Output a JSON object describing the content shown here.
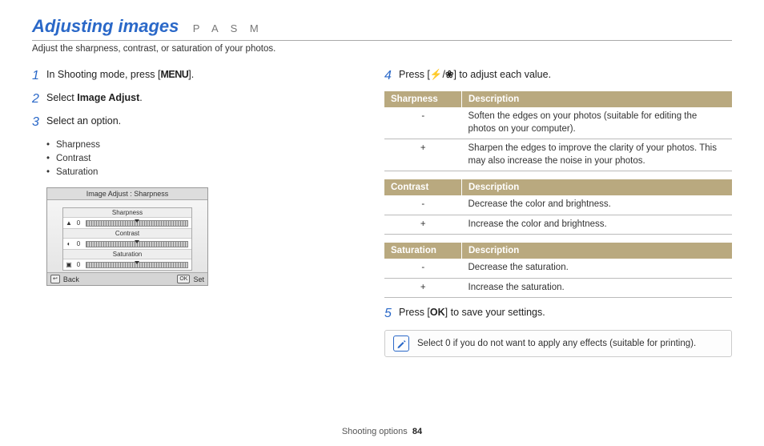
{
  "header": {
    "title": "Adjusting images",
    "modes": "P A S M",
    "subtitle": "Adjust the sharpness, contrast, or saturation of your photos."
  },
  "steps": {
    "s1": {
      "num": "1",
      "pre": "In Shooting mode, press [",
      "menu": "MENU",
      "post": "]."
    },
    "s2": {
      "num": "2",
      "pre": "Select ",
      "bold": "Image Adjust",
      "post": "."
    },
    "s3": {
      "num": "3",
      "text": "Select an option.",
      "bullets": [
        "Sharpness",
        "Contrast",
        "Saturation"
      ]
    },
    "s4": {
      "num": "4",
      "pre": "Press [",
      "icon1": "⚡",
      "sep": "/",
      "icon2": "❀",
      "post": "] to adjust each value."
    },
    "s5": {
      "num": "5",
      "pre": "Press [",
      "ok": "OK",
      "post": "] to save your settings."
    }
  },
  "camera": {
    "title": "Image Adjust : Sharpness",
    "row_labels": [
      "Sharpness",
      "Contrast",
      "Saturation"
    ],
    "row_vals": [
      "0",
      "0",
      "0"
    ],
    "icons": [
      "▲",
      "◐",
      "▣"
    ],
    "back_icon": "↩",
    "back": "Back",
    "ok_icon": "OK",
    "set": "Set"
  },
  "tables": {
    "sharpness": {
      "head1": "Sharpness",
      "head2": "Description",
      "rows": [
        {
          "k": "-",
          "v": "Soften the edges on your photos (suitable for editing the photos on your computer)."
        },
        {
          "k": "+",
          "v": "Sharpen the edges to improve the clarity of your photos. This may also increase the noise in your photos."
        }
      ]
    },
    "contrast": {
      "head1": "Contrast",
      "head2": "Description",
      "rows": [
        {
          "k": "-",
          "v": "Decrease the color and brightness."
        },
        {
          "k": "+",
          "v": "Increase the color and brightness."
        }
      ]
    },
    "saturation": {
      "head1": "Saturation",
      "head2": "Description",
      "rows": [
        {
          "k": "-",
          "v": "Decrease the saturation."
        },
        {
          "k": "+",
          "v": "Increase the saturation."
        }
      ]
    }
  },
  "note": {
    "icon": "✎",
    "text": "Select 0 if you do not want to apply any effects (suitable for printing)."
  },
  "footer": {
    "section": "Shooting options",
    "page": "84"
  }
}
